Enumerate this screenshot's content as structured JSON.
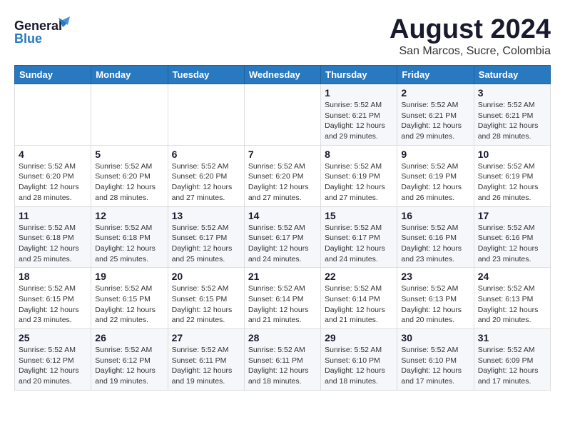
{
  "header": {
    "logo_line1": "General",
    "logo_line2": "Blue",
    "title": "August 2024",
    "subtitle": "San Marcos, Sucre, Colombia"
  },
  "calendar": {
    "headers": [
      "Sunday",
      "Monday",
      "Tuesday",
      "Wednesday",
      "Thursday",
      "Friday",
      "Saturday"
    ],
    "weeks": [
      [
        {
          "day": "",
          "info": ""
        },
        {
          "day": "",
          "info": ""
        },
        {
          "day": "",
          "info": ""
        },
        {
          "day": "",
          "info": ""
        },
        {
          "day": "1",
          "info": "Sunrise: 5:52 AM\nSunset: 6:21 PM\nDaylight: 12 hours\nand 29 minutes."
        },
        {
          "day": "2",
          "info": "Sunrise: 5:52 AM\nSunset: 6:21 PM\nDaylight: 12 hours\nand 29 minutes."
        },
        {
          "day": "3",
          "info": "Sunrise: 5:52 AM\nSunset: 6:21 PM\nDaylight: 12 hours\nand 28 minutes."
        }
      ],
      [
        {
          "day": "4",
          "info": "Sunrise: 5:52 AM\nSunset: 6:20 PM\nDaylight: 12 hours\nand 28 minutes."
        },
        {
          "day": "5",
          "info": "Sunrise: 5:52 AM\nSunset: 6:20 PM\nDaylight: 12 hours\nand 28 minutes."
        },
        {
          "day": "6",
          "info": "Sunrise: 5:52 AM\nSunset: 6:20 PM\nDaylight: 12 hours\nand 27 minutes."
        },
        {
          "day": "7",
          "info": "Sunrise: 5:52 AM\nSunset: 6:20 PM\nDaylight: 12 hours\nand 27 minutes."
        },
        {
          "day": "8",
          "info": "Sunrise: 5:52 AM\nSunset: 6:19 PM\nDaylight: 12 hours\nand 27 minutes."
        },
        {
          "day": "9",
          "info": "Sunrise: 5:52 AM\nSunset: 6:19 PM\nDaylight: 12 hours\nand 26 minutes."
        },
        {
          "day": "10",
          "info": "Sunrise: 5:52 AM\nSunset: 6:19 PM\nDaylight: 12 hours\nand 26 minutes."
        }
      ],
      [
        {
          "day": "11",
          "info": "Sunrise: 5:52 AM\nSunset: 6:18 PM\nDaylight: 12 hours\nand 25 minutes."
        },
        {
          "day": "12",
          "info": "Sunrise: 5:52 AM\nSunset: 6:18 PM\nDaylight: 12 hours\nand 25 minutes."
        },
        {
          "day": "13",
          "info": "Sunrise: 5:52 AM\nSunset: 6:17 PM\nDaylight: 12 hours\nand 25 minutes."
        },
        {
          "day": "14",
          "info": "Sunrise: 5:52 AM\nSunset: 6:17 PM\nDaylight: 12 hours\nand 24 minutes."
        },
        {
          "day": "15",
          "info": "Sunrise: 5:52 AM\nSunset: 6:17 PM\nDaylight: 12 hours\nand 24 minutes."
        },
        {
          "day": "16",
          "info": "Sunrise: 5:52 AM\nSunset: 6:16 PM\nDaylight: 12 hours\nand 23 minutes."
        },
        {
          "day": "17",
          "info": "Sunrise: 5:52 AM\nSunset: 6:16 PM\nDaylight: 12 hours\nand 23 minutes."
        }
      ],
      [
        {
          "day": "18",
          "info": "Sunrise: 5:52 AM\nSunset: 6:15 PM\nDaylight: 12 hours\nand 23 minutes."
        },
        {
          "day": "19",
          "info": "Sunrise: 5:52 AM\nSunset: 6:15 PM\nDaylight: 12 hours\nand 22 minutes."
        },
        {
          "day": "20",
          "info": "Sunrise: 5:52 AM\nSunset: 6:15 PM\nDaylight: 12 hours\nand 22 minutes."
        },
        {
          "day": "21",
          "info": "Sunrise: 5:52 AM\nSunset: 6:14 PM\nDaylight: 12 hours\nand 21 minutes."
        },
        {
          "day": "22",
          "info": "Sunrise: 5:52 AM\nSunset: 6:14 PM\nDaylight: 12 hours\nand 21 minutes."
        },
        {
          "day": "23",
          "info": "Sunrise: 5:52 AM\nSunset: 6:13 PM\nDaylight: 12 hours\nand 20 minutes."
        },
        {
          "day": "24",
          "info": "Sunrise: 5:52 AM\nSunset: 6:13 PM\nDaylight: 12 hours\nand 20 minutes."
        }
      ],
      [
        {
          "day": "25",
          "info": "Sunrise: 5:52 AM\nSunset: 6:12 PM\nDaylight: 12 hours\nand 20 minutes."
        },
        {
          "day": "26",
          "info": "Sunrise: 5:52 AM\nSunset: 6:12 PM\nDaylight: 12 hours\nand 19 minutes."
        },
        {
          "day": "27",
          "info": "Sunrise: 5:52 AM\nSunset: 6:11 PM\nDaylight: 12 hours\nand 19 minutes."
        },
        {
          "day": "28",
          "info": "Sunrise: 5:52 AM\nSunset: 6:11 PM\nDaylight: 12 hours\nand 18 minutes."
        },
        {
          "day": "29",
          "info": "Sunrise: 5:52 AM\nSunset: 6:10 PM\nDaylight: 12 hours\nand 18 minutes."
        },
        {
          "day": "30",
          "info": "Sunrise: 5:52 AM\nSunset: 6:10 PM\nDaylight: 12 hours\nand 17 minutes."
        },
        {
          "day": "31",
          "info": "Sunrise: 5:52 AM\nSunset: 6:09 PM\nDaylight: 12 hours\nand 17 minutes."
        }
      ]
    ]
  }
}
